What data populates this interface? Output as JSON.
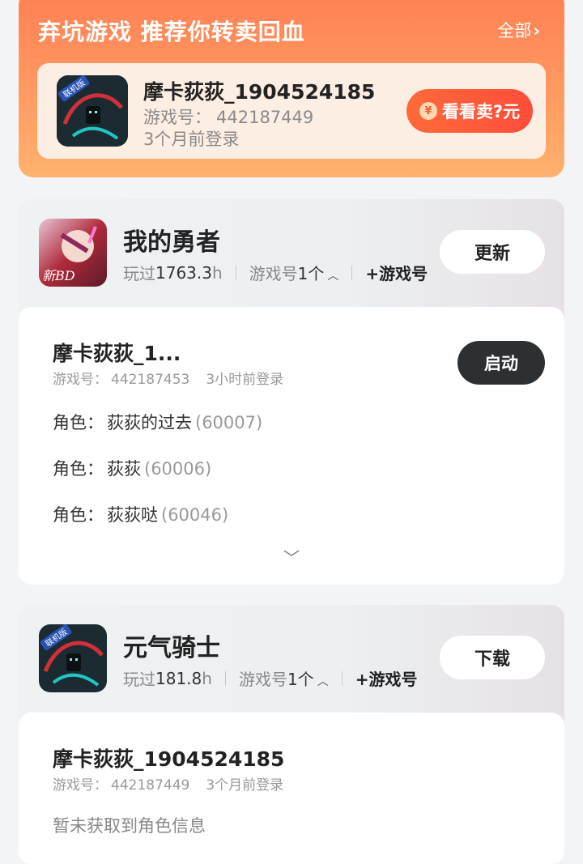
{
  "promo": {
    "title": "弃坑游戏 推荐你转卖回血",
    "all_label": "全部",
    "card": {
      "name": "摩卡荻荻_1904524185",
      "game_id_label": "游戏号：",
      "game_id": "442187449",
      "last_login": "3个月前登录",
      "sell_label": "看看卖?元",
      "coin_symbol": "¥",
      "badge_text": "联机版"
    }
  },
  "games": [
    {
      "title": "我的勇者",
      "playtime_label": "玩过",
      "playtime_value": "1763.3",
      "playtime_unit": "h",
      "accounts_label": "游戏号",
      "accounts_count": "1个",
      "add_label": "+游戏号",
      "action_label": "更新",
      "icon_text": "新BD",
      "account": {
        "name": "摩卡荻荻_1...",
        "game_id_label": "游戏号：",
        "game_id": "442187453",
        "last_login": "3小时前登录",
        "launch_label": "启动",
        "roles": [
          {
            "label": "角色：",
            "name": "荻荻的过去",
            "id": "(60007)"
          },
          {
            "label": "角色：",
            "name": "荻荻",
            "id": "(60006)"
          },
          {
            "label": "角色：",
            "name": "荻荻哒",
            "id": "(60046)"
          }
        ]
      }
    },
    {
      "title": "元气骑士",
      "playtime_label": "玩过",
      "playtime_value": "181.8",
      "playtime_unit": "h",
      "accounts_label": "游戏号",
      "accounts_count": "1个",
      "add_label": "+游戏号",
      "action_label": "下载",
      "icon_text": "联机版",
      "account": {
        "name": "摩卡荻荻_1904524185",
        "game_id_label": "游戏号：",
        "game_id": "442187449",
        "last_login": "3个月前登录",
        "no_role_text": "暂未获取到角色信息"
      }
    }
  ]
}
